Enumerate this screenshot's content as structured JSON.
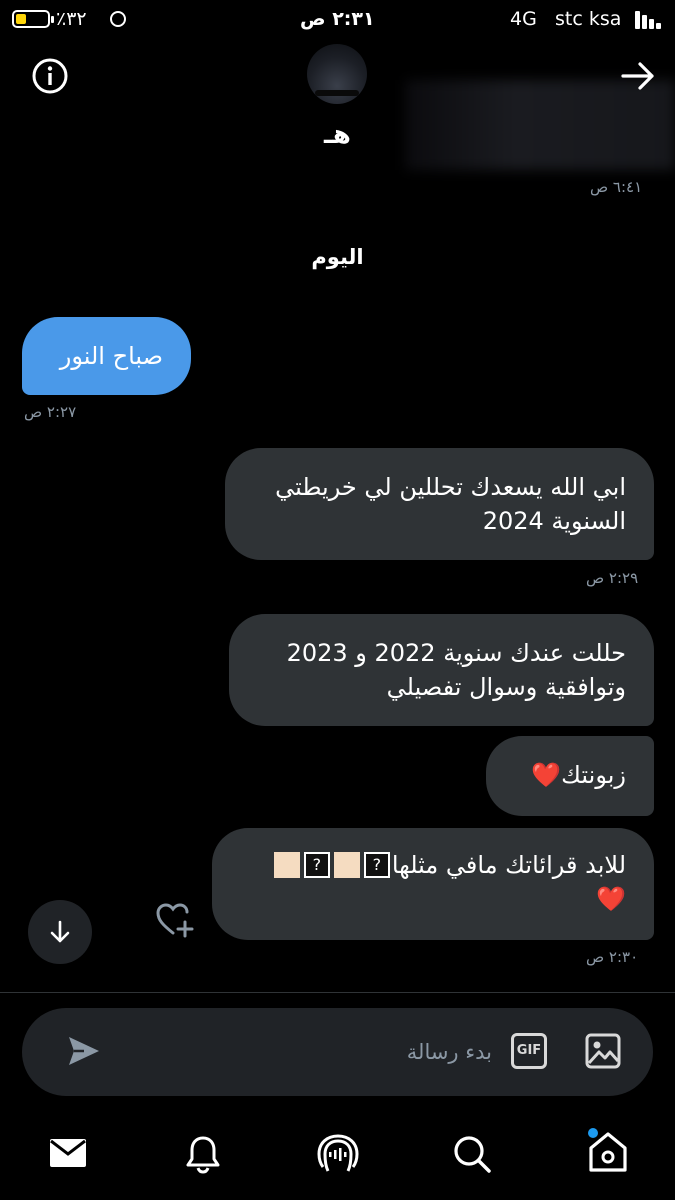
{
  "status_bar": {
    "carrier": "stc ksa",
    "network": "4G",
    "time": "٢:٣١ ص",
    "battery": "٪٣٢"
  },
  "header": {
    "title": "هـ",
    "info_icon": "info-icon",
    "back_icon": "arrow-right-icon"
  },
  "messages": {
    "prev_time": "٦:٤١ ص",
    "day_separator": "اليوم",
    "m1": {
      "text": "صباح النور",
      "time": "٢:٢٧ ص"
    },
    "m2": {
      "line1": "ابي الله يسعدك تحللين لي خريطتي",
      "line2": "السنوية 2024",
      "time": "٢:٢٩ ص"
    },
    "m3": {
      "line1": "حللت عندك سنوية 2022 و 2023",
      "line2": "وتوافقية وسوال تفصيلي"
    },
    "m4": {
      "text": "زبونتك❤️"
    },
    "m5": {
      "line1": "للابد قرائاتك مافي مثلها",
      "line2": "❤️",
      "time": "٢:٣٠ ص"
    }
  },
  "composer": {
    "placeholder": "بدء رسالة",
    "gif_label": "GIF"
  },
  "colors": {
    "accent": "#4a99e9",
    "sent_bubble": "#2f3336",
    "timestamp": "#8b98a5"
  }
}
